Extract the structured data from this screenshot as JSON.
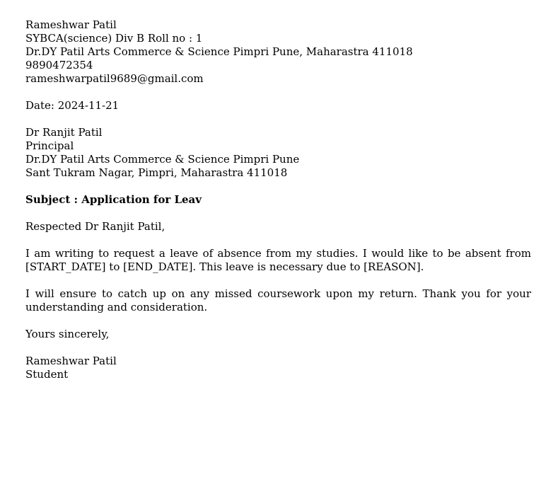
{
  "sender": {
    "name": "Rameshwar Patil",
    "class_roll": "SYBCA(science) Div B Roll no : 1",
    "college_address": "Dr.DY Patil Arts Commerce & Science Pimpri Pune, Maharastra 411018",
    "phone": "9890472354",
    "email": "rameshwarpatil9689@gmail.com"
  },
  "date_line": "Date: 2024-11-21",
  "recipient": {
    "name": "Dr Ranjit Patil",
    "title": "Principal",
    "college": "Dr.DY Patil Arts Commerce &  Science Pimpri Pune",
    "address": "Sant Tukram Nagar, Pimpri, Maharastra 411018"
  },
  "subject": "Subject : Application for Leav",
  "salutation": "Respected Dr Ranjit Patil,",
  "body": {
    "paragraph_1": "I am writing to request a leave of absence from my studies. I would like to be absent from [START_DATE] to [END_DATE].  This leave is necessary due to [REASON].",
    "paragraph_2": "I will ensure to catch up on any missed coursework upon my return.  Thank you for your understanding and consideration."
  },
  "closing": "Yours sincerely,",
  "signature": {
    "name": "Rameshwar Patil",
    "role": "Student"
  }
}
